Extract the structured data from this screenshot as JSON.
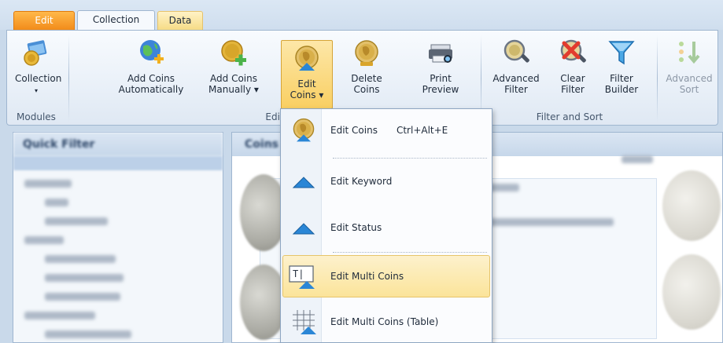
{
  "tabs": {
    "edit": "Edit",
    "collection": "Collection",
    "data": "Data"
  },
  "ribbon": {
    "collection": {
      "label": "Collection",
      "arrow": "▾"
    },
    "add_auto": {
      "line1": "Add Coins",
      "line2": "Automatically"
    },
    "add_manual": {
      "line1": "Add Coins",
      "line2": "Manually ▾"
    },
    "edit_coins": {
      "line1": "Edit",
      "line2": "Coins ▾"
    },
    "delete_coins": {
      "line1": "Delete",
      "line2": "Coins"
    },
    "print_preview": {
      "line1": "Print",
      "line2": "Preview"
    },
    "advanced_filter": {
      "line1": "Advanced",
      "line2": "Filter"
    },
    "clear_filter": {
      "line1": "Clear",
      "line2": "Filter"
    },
    "filter_builder": {
      "line1": "Filter",
      "line2": "Builder"
    },
    "advanced_sort": {
      "line1": "Advanced",
      "line2": "Sort"
    },
    "groups": {
      "modules": "Modules",
      "edit": "Edit",
      "filter_sort": "Filter and Sort"
    }
  },
  "left_panel": {
    "title": "Quick Filter"
  },
  "main_panel": {
    "title": "Coins"
  },
  "menu": {
    "items": [
      {
        "label": "Edit Coins",
        "shortcut": "Ctrl+Alt+E",
        "icon": "coin-edit-icon"
      },
      {
        "label": "Edit Keyword",
        "icon": "triangle-icon"
      },
      {
        "label": "Edit Status",
        "icon": "triangle-icon"
      },
      {
        "label": "Edit Multi Coins",
        "icon": "multi-edit-icon"
      },
      {
        "label": "Edit Multi Coins (Table)",
        "icon": "table-edit-icon"
      }
    ]
  },
  "colors": {
    "accent_orange": "#f28c1a",
    "highlight": "#fbe49a",
    "ribbon_border": "#9fb6d0"
  }
}
